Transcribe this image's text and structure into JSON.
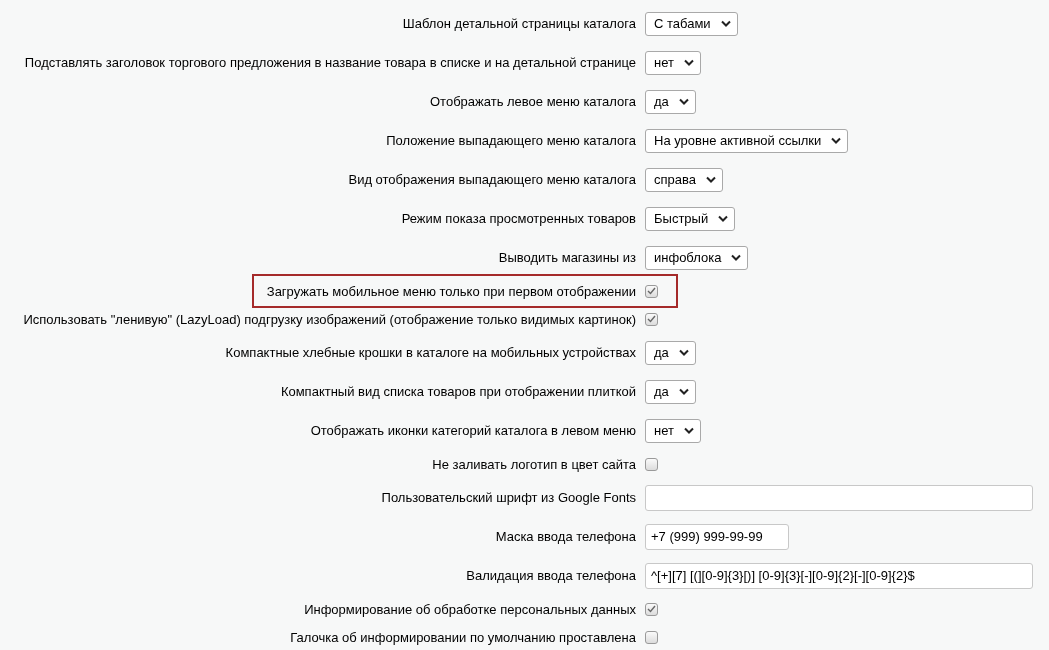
{
  "settings": [
    {
      "kind": "select",
      "label": "Шаблон детальной страницы каталога",
      "value": "С табами"
    },
    {
      "kind": "select",
      "label": "Подставлять заголовок торгового предложения в название товара в списке и на детальной странице",
      "value": "нет"
    },
    {
      "kind": "select",
      "label": "Отображать левое меню каталога",
      "value": "да"
    },
    {
      "kind": "select",
      "label": "Положение выпадающего меню каталога",
      "value": "На уровне активной ссылки"
    },
    {
      "kind": "select",
      "label": "Вид отображения выпадающего меню каталога",
      "value": "справа"
    },
    {
      "kind": "select",
      "label": "Режим показа просмотренных товаров",
      "value": "Быстрый"
    },
    {
      "kind": "select",
      "label": "Выводить магазины из",
      "value": "инфоблока"
    },
    {
      "kind": "checkbox",
      "label": "Загружать мобильное меню только при первом отображении",
      "checked": true,
      "highlighted": true
    },
    {
      "kind": "checkbox",
      "label": "Использовать \"ленивую\" (LazyLoad) подгрузку изображений (отображение только видимых картинок)",
      "checked": true,
      "highlighted": false
    },
    {
      "kind": "select",
      "label": "Компактные хлебные крошки в каталоге на мобильных устройствах",
      "value": "да"
    },
    {
      "kind": "select",
      "label": "Компактный вид списка товаров при отображении плиткой",
      "value": "да"
    },
    {
      "kind": "select",
      "label": "Отображать иконки категорий каталога в левом меню",
      "value": "нет"
    },
    {
      "kind": "checkbox",
      "label": "Не заливать логотип в цвет сайта",
      "checked": false,
      "highlighted": false
    },
    {
      "kind": "text",
      "label": "Пользовательский шрифт из Google Fonts"
    },
    {
      "kind": "text",
      "label": "Маска ввода телефона",
      "value": "+7 (999) 999-99-99"
    },
    {
      "kind": "text",
      "label": "Валидация ввода телефона",
      "value": "^[+][7] [(][0-9]{3}[)] [0-9]{3}[-][0-9]{2}[-][0-9]{2}$"
    },
    {
      "kind": "checkbox",
      "label": "Информирование об обработке персональных данных",
      "checked": true,
      "highlighted": false
    },
    {
      "kind": "checkbox",
      "label": "Галочка об информировании по умолчанию проставлена",
      "checked": false,
      "highlighted": false
    }
  ]
}
